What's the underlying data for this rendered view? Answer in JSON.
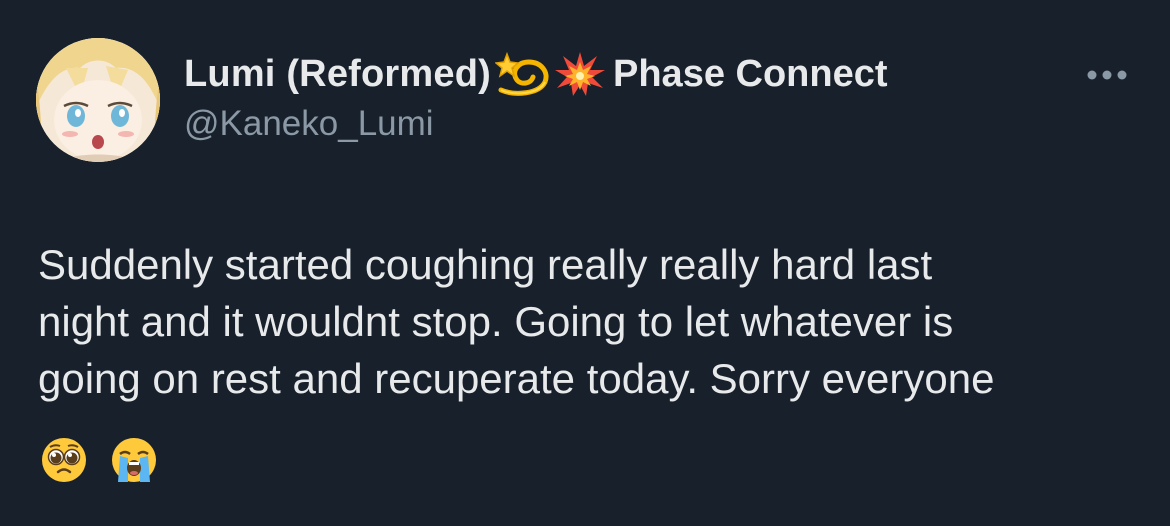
{
  "tweet": {
    "author": {
      "display_name": "Lumi (Reformed)",
      "affiliation": "Phase Connect",
      "handle": "@Kaneko_Lumi"
    },
    "name_emojis": [
      "dizzy-emoji",
      "collision-emoji"
    ],
    "more_icon": "more-options-icon",
    "text_lines": [
      "Suddenly started coughing really really hard last",
      "night and it wouldnt stop. Going to let whatever is",
      "going on rest and recuperate today. Sorry everyone"
    ],
    "text_emojis": [
      "pleading-face-emoji",
      "loudly-crying-face-emoji"
    ]
  },
  "colors": {
    "background": "#17202b",
    "primary_text": "#e7e9ea",
    "secondary_text": "#8b98a5"
  }
}
